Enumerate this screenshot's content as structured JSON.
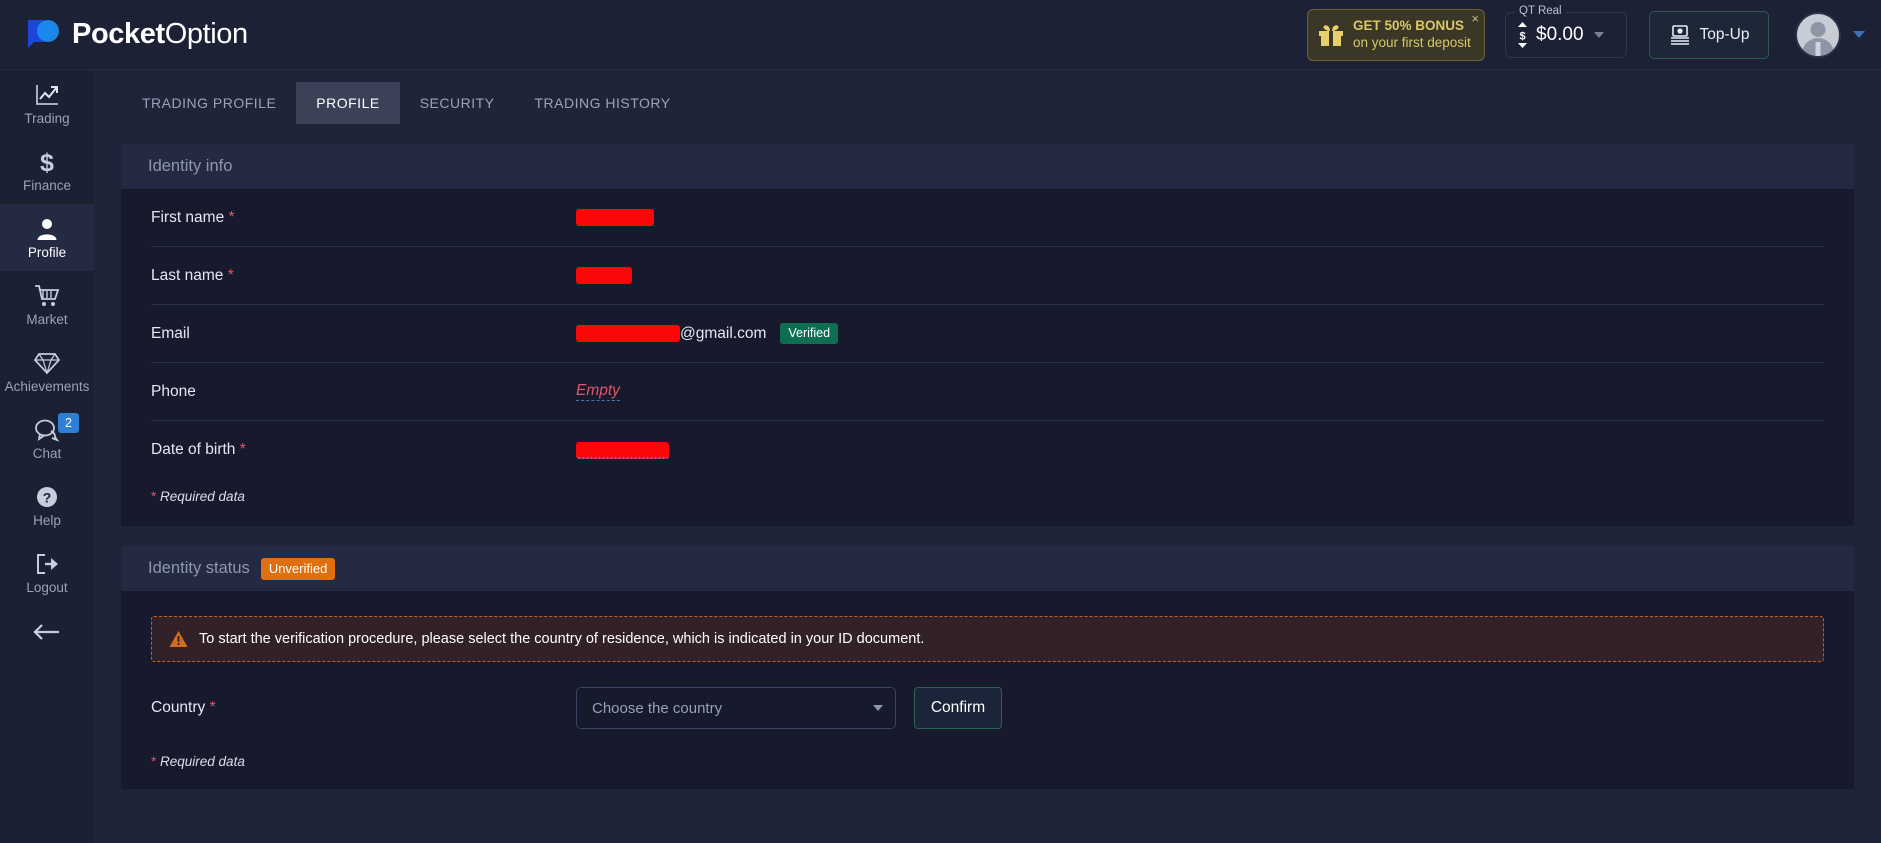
{
  "header": {
    "logo_text_bold": "Pocket",
    "logo_text_thin": "Option",
    "bonus": {
      "line1": "GET 50% BONUS",
      "line2": "on your first deposit",
      "close": "×",
      "icon": "gift-icon"
    },
    "balance": {
      "account_label": "QT Real",
      "amount": "$0.00",
      "icon": "updown-dollar-icon"
    },
    "topup_label": "Top-Up",
    "topup_icon": "cash-withdraw-icon",
    "avatar_icon": "user-avatar"
  },
  "sidebar": {
    "items": [
      {
        "label": "Trading",
        "icon": "chart-line-icon",
        "active": false,
        "badge": ""
      },
      {
        "label": "Finance",
        "icon": "dollar-icon",
        "active": false,
        "badge": ""
      },
      {
        "label": "Profile",
        "icon": "user-icon",
        "active": true,
        "badge": ""
      },
      {
        "label": "Market",
        "icon": "cart-icon",
        "active": false,
        "badge": ""
      },
      {
        "label": "Achievements",
        "icon": "diamond-icon",
        "active": false,
        "badge": ""
      },
      {
        "label": "Chat",
        "icon": "chat-bubble-icon",
        "active": false,
        "badge": "2"
      },
      {
        "label": "Help",
        "icon": "question-mark-icon",
        "active": false,
        "badge": ""
      },
      {
        "label": "Logout",
        "icon": "logout-icon",
        "active": false,
        "badge": ""
      }
    ],
    "collapse_icon": "arrow-left-icon"
  },
  "tabs": [
    {
      "label": "TRADING PROFILE",
      "active": false
    },
    {
      "label": "PROFILE",
      "active": true
    },
    {
      "label": "SECURITY",
      "active": false
    },
    {
      "label": "TRADING HISTORY",
      "active": false
    }
  ],
  "identity_info": {
    "title": "Identity info",
    "fields": [
      {
        "label": "First name",
        "required": true,
        "value": "",
        "redacted": true,
        "redact_width": 78,
        "dotted": false,
        "badge": ""
      },
      {
        "label": "Last name",
        "required": true,
        "value": "",
        "redacted": true,
        "redact_width": 56,
        "dotted": false,
        "badge": ""
      },
      {
        "label": "Email",
        "required": false,
        "value": "@gmail.com",
        "redacted": true,
        "redact_width": 104,
        "dotted": false,
        "badge": "Verified"
      },
      {
        "label": "Phone",
        "required": false,
        "value": "Empty",
        "redacted": false,
        "redact_width": 0,
        "dotted": false,
        "badge": ""
      },
      {
        "label": "Date of birth",
        "required": true,
        "value": "",
        "redacted": true,
        "redact_width": 93,
        "dotted": true,
        "badge": ""
      }
    ],
    "required_note_star": "*",
    "required_note_text": " Required data"
  },
  "identity_status": {
    "title": "Identity status",
    "status_badge": "Unverified",
    "warning_icon": "warning-triangle-icon",
    "warning_text": "To start the verification procedure, please select the country of residence, which is indicated in your ID document.",
    "country_label": "Country",
    "country_required": true,
    "country_placeholder": "Choose the country",
    "confirm_label": "Confirm",
    "required_note_star": "*",
    "required_note_text": " Required data"
  },
  "colors": {
    "accent_blue": "#2f7fd4",
    "verified_green": "#0e6e52",
    "unverified_orange": "#e0700f",
    "required_red": "#e0566b",
    "bonus_gold": "#d9c66a",
    "redact_red": "#fb0707"
  }
}
